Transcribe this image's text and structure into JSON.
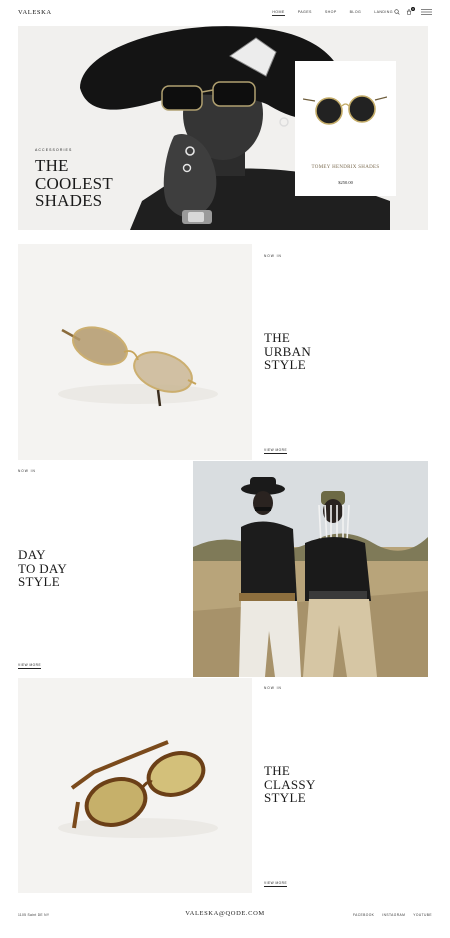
{
  "header": {
    "logo": "VALESKA",
    "nav": [
      "HOME",
      "PAGES",
      "SHOP",
      "BLOG",
      "LANDING"
    ],
    "cart_count": "0"
  },
  "hero": {
    "subtitle": "ACCESSORIES",
    "title": "THE\nCOOLEST\nSHADES",
    "product": {
      "name": "TOMEY HENDRIX SHADES",
      "price": "$250.00"
    }
  },
  "sections": [
    {
      "tag": "NOW IN",
      "title": "THE\nURBAN\nSTYLE",
      "link": "VIEW MORE"
    },
    {
      "tag": "NOW IN",
      "title": "DAY\nTO DAY\nSTYLE",
      "link": "VIEW MORE"
    },
    {
      "tag": "NOW IN",
      "title": "THE\nCLASSY\nSTYLE",
      "link": "VIEW MORE"
    }
  ],
  "footer": {
    "address": "1105 Saint DE NY",
    "email": "VALESKA@QODE.COM",
    "social": [
      "FACEBOOK",
      "INSTAGRAM",
      "YOUTUBE"
    ]
  },
  "colors": {
    "accent": "#7a6a4f",
    "panel_bg": "#f4f3f1",
    "text": "#1a1a1a"
  },
  "icons": [
    "search-icon",
    "cart-icon",
    "menu-icon"
  ]
}
